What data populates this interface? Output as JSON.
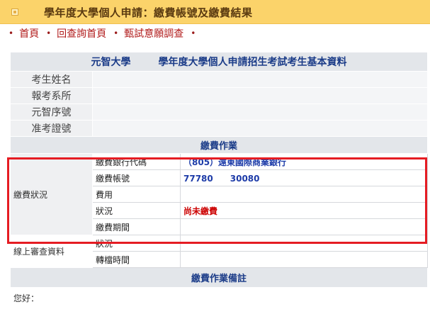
{
  "header": {
    "title": "學年度大學個人申請：繳費帳號及繳費結果"
  },
  "nav": {
    "items": [
      {
        "label": "首頁"
      },
      {
        "label": "回查詢首頁"
      },
      {
        "label": "甄試意願調查"
      }
    ],
    "bullet": "•"
  },
  "table": {
    "title_school": "元智大學",
    "title_text": "學年度大學個人申請招生考試考生基本資料",
    "basic_rows": [
      {
        "label": "考生姓名",
        "value": ""
      },
      {
        "label": "報考系所",
        "value": ""
      },
      {
        "label": "元智序號",
        "value": ""
      },
      {
        "label": "准考證號",
        "value": ""
      }
    ],
    "payment_section": "繳費作業",
    "payment_status_label": "繳費狀況",
    "payment_rows": [
      {
        "label": "繳費銀行代碼",
        "value": "（805）遠東國際商業銀行"
      },
      {
        "label": "繳費帳號",
        "value": "77780　　30080"
      },
      {
        "label": "費用",
        "value": ""
      },
      {
        "label": "狀況",
        "value": "尚未繳費"
      },
      {
        "label": "繳費期間",
        "value": ""
      }
    ],
    "review_label": "線上審查資料",
    "review_rows": [
      {
        "label": "狀況",
        "value": ""
      },
      {
        "label": "轉檔時間",
        "value": ""
      }
    ],
    "notes_section": "繳費作業備註",
    "greeting": "您好："
  },
  "colors": {
    "title_bar": "#fbd36a",
    "header_text": "#1a3b88",
    "highlight": "#e51c23",
    "status_red": "#cc0000"
  }
}
